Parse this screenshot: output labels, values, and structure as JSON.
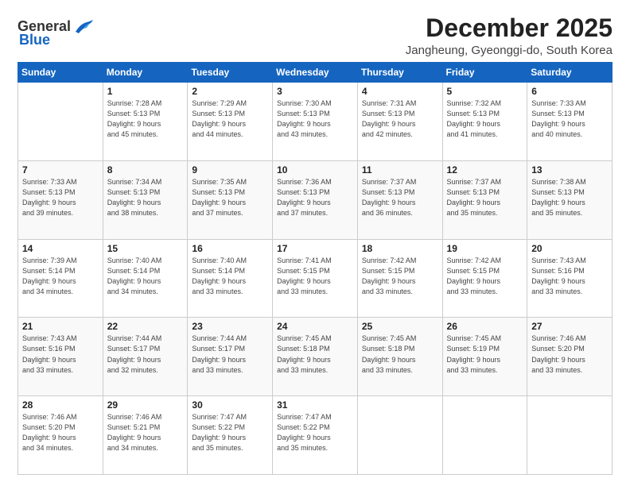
{
  "logo": {
    "general": "General",
    "blue": "Blue"
  },
  "title": "December 2025",
  "location": "Jangheung, Gyeonggi-do, South Korea",
  "weekdays": [
    "Sunday",
    "Monday",
    "Tuesday",
    "Wednesday",
    "Thursday",
    "Friday",
    "Saturday"
  ],
  "weeks": [
    [
      {
        "day": "",
        "info": ""
      },
      {
        "day": "1",
        "info": "Sunrise: 7:28 AM\nSunset: 5:13 PM\nDaylight: 9 hours\nand 45 minutes."
      },
      {
        "day": "2",
        "info": "Sunrise: 7:29 AM\nSunset: 5:13 PM\nDaylight: 9 hours\nand 44 minutes."
      },
      {
        "day": "3",
        "info": "Sunrise: 7:30 AM\nSunset: 5:13 PM\nDaylight: 9 hours\nand 43 minutes."
      },
      {
        "day": "4",
        "info": "Sunrise: 7:31 AM\nSunset: 5:13 PM\nDaylight: 9 hours\nand 42 minutes."
      },
      {
        "day": "5",
        "info": "Sunrise: 7:32 AM\nSunset: 5:13 PM\nDaylight: 9 hours\nand 41 minutes."
      },
      {
        "day": "6",
        "info": "Sunrise: 7:33 AM\nSunset: 5:13 PM\nDaylight: 9 hours\nand 40 minutes."
      }
    ],
    [
      {
        "day": "7",
        "info": "Sunrise: 7:33 AM\nSunset: 5:13 PM\nDaylight: 9 hours\nand 39 minutes."
      },
      {
        "day": "8",
        "info": "Sunrise: 7:34 AM\nSunset: 5:13 PM\nDaylight: 9 hours\nand 38 minutes."
      },
      {
        "day": "9",
        "info": "Sunrise: 7:35 AM\nSunset: 5:13 PM\nDaylight: 9 hours\nand 37 minutes."
      },
      {
        "day": "10",
        "info": "Sunrise: 7:36 AM\nSunset: 5:13 PM\nDaylight: 9 hours\nand 37 minutes."
      },
      {
        "day": "11",
        "info": "Sunrise: 7:37 AM\nSunset: 5:13 PM\nDaylight: 9 hours\nand 36 minutes."
      },
      {
        "day": "12",
        "info": "Sunrise: 7:37 AM\nSunset: 5:13 PM\nDaylight: 9 hours\nand 35 minutes."
      },
      {
        "day": "13",
        "info": "Sunrise: 7:38 AM\nSunset: 5:13 PM\nDaylight: 9 hours\nand 35 minutes."
      }
    ],
    [
      {
        "day": "14",
        "info": "Sunrise: 7:39 AM\nSunset: 5:14 PM\nDaylight: 9 hours\nand 34 minutes."
      },
      {
        "day": "15",
        "info": "Sunrise: 7:40 AM\nSunset: 5:14 PM\nDaylight: 9 hours\nand 34 minutes."
      },
      {
        "day": "16",
        "info": "Sunrise: 7:40 AM\nSunset: 5:14 PM\nDaylight: 9 hours\nand 33 minutes."
      },
      {
        "day": "17",
        "info": "Sunrise: 7:41 AM\nSunset: 5:15 PM\nDaylight: 9 hours\nand 33 minutes."
      },
      {
        "day": "18",
        "info": "Sunrise: 7:42 AM\nSunset: 5:15 PM\nDaylight: 9 hours\nand 33 minutes."
      },
      {
        "day": "19",
        "info": "Sunrise: 7:42 AM\nSunset: 5:15 PM\nDaylight: 9 hours\nand 33 minutes."
      },
      {
        "day": "20",
        "info": "Sunrise: 7:43 AM\nSunset: 5:16 PM\nDaylight: 9 hours\nand 33 minutes."
      }
    ],
    [
      {
        "day": "21",
        "info": "Sunrise: 7:43 AM\nSunset: 5:16 PM\nDaylight: 9 hours\nand 33 minutes."
      },
      {
        "day": "22",
        "info": "Sunrise: 7:44 AM\nSunset: 5:17 PM\nDaylight: 9 hours\nand 32 minutes."
      },
      {
        "day": "23",
        "info": "Sunrise: 7:44 AM\nSunset: 5:17 PM\nDaylight: 9 hours\nand 33 minutes."
      },
      {
        "day": "24",
        "info": "Sunrise: 7:45 AM\nSunset: 5:18 PM\nDaylight: 9 hours\nand 33 minutes."
      },
      {
        "day": "25",
        "info": "Sunrise: 7:45 AM\nSunset: 5:18 PM\nDaylight: 9 hours\nand 33 minutes."
      },
      {
        "day": "26",
        "info": "Sunrise: 7:45 AM\nSunset: 5:19 PM\nDaylight: 9 hours\nand 33 minutes."
      },
      {
        "day": "27",
        "info": "Sunrise: 7:46 AM\nSunset: 5:20 PM\nDaylight: 9 hours\nand 33 minutes."
      }
    ],
    [
      {
        "day": "28",
        "info": "Sunrise: 7:46 AM\nSunset: 5:20 PM\nDaylight: 9 hours\nand 34 minutes."
      },
      {
        "day": "29",
        "info": "Sunrise: 7:46 AM\nSunset: 5:21 PM\nDaylight: 9 hours\nand 34 minutes."
      },
      {
        "day": "30",
        "info": "Sunrise: 7:47 AM\nSunset: 5:22 PM\nDaylight: 9 hours\nand 35 minutes."
      },
      {
        "day": "31",
        "info": "Sunrise: 7:47 AM\nSunset: 5:22 PM\nDaylight: 9 hours\nand 35 minutes."
      },
      {
        "day": "",
        "info": ""
      },
      {
        "day": "",
        "info": ""
      },
      {
        "day": "",
        "info": ""
      }
    ]
  ]
}
